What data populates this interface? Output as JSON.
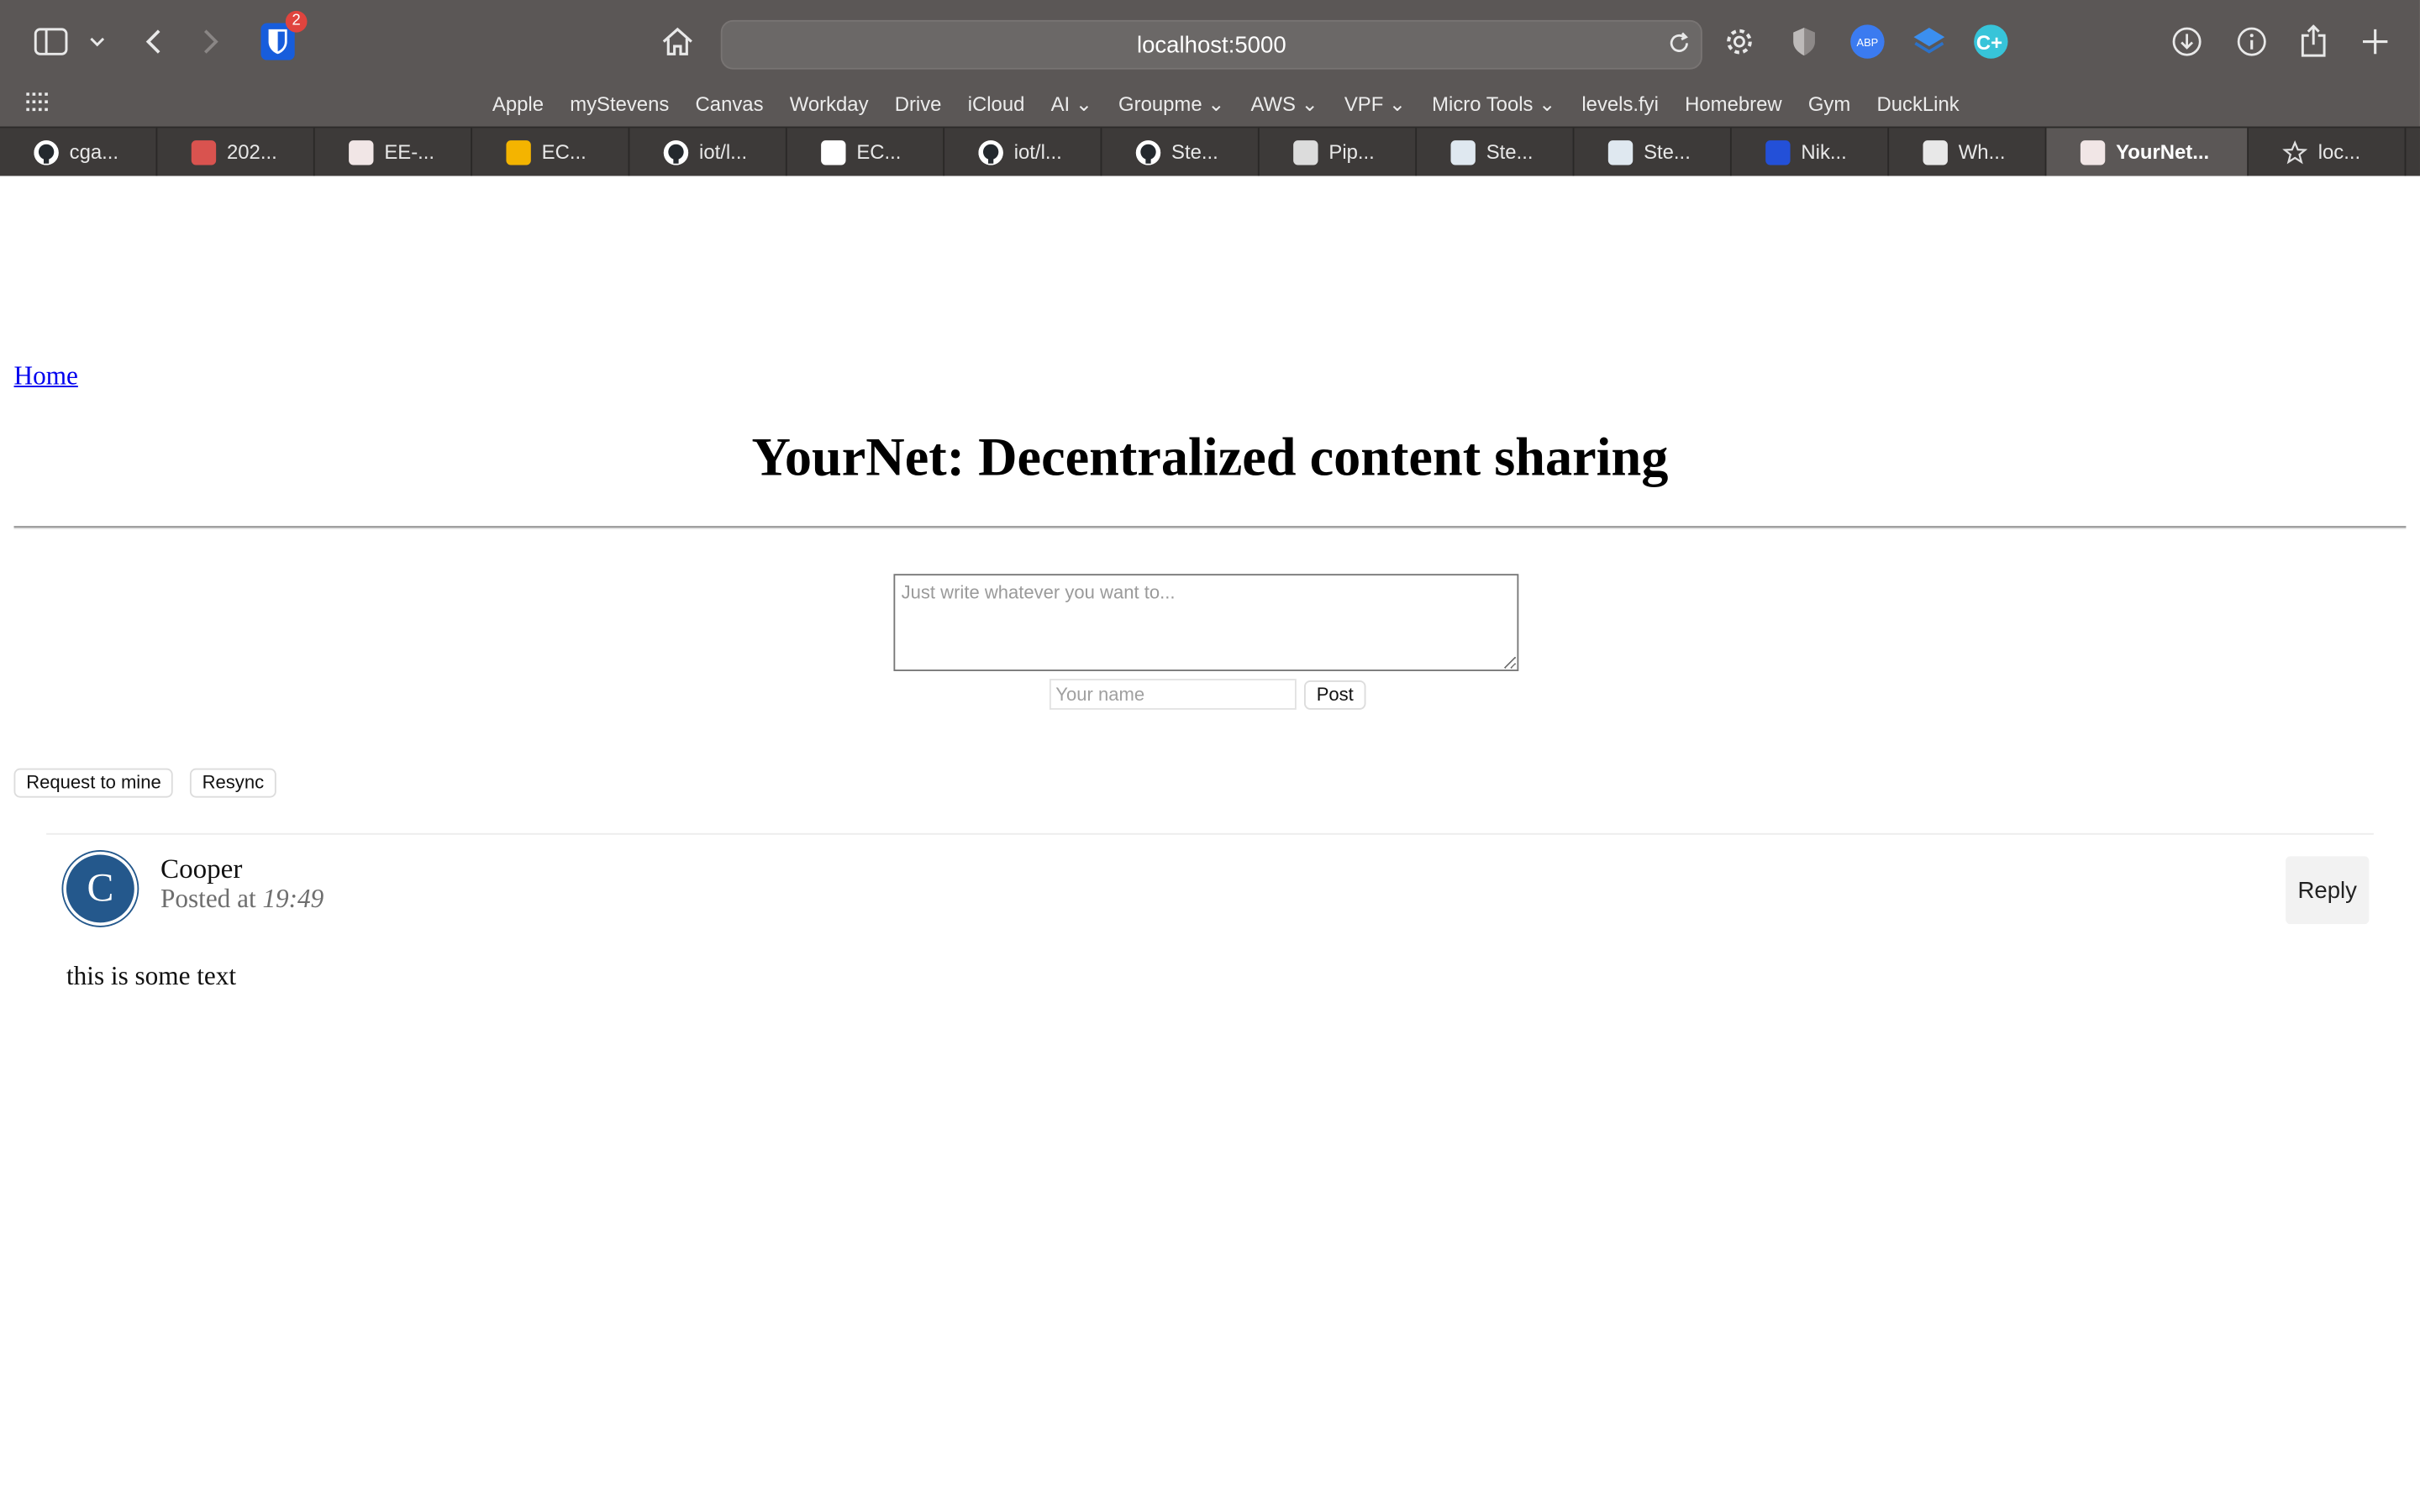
{
  "browser": {
    "url": "localhost:5000",
    "bitwarden_badge": "2",
    "bookmarks": [
      "Apple",
      "myStevens",
      "Canvas",
      "Workday",
      "Drive",
      "iCloud",
      "AI ⌄",
      "Groupme ⌄",
      "AWS ⌄",
      "VPF ⌄",
      "Micro Tools ⌄",
      "levels.fyi",
      "Homebrew",
      "Gym",
      "DuckLink"
    ],
    "tabs": [
      {
        "label": "cga...",
        "icon": "github-icon",
        "color": "#ffffff"
      },
      {
        "label": "202...",
        "icon": "red-logo-icon",
        "color": "#d9534f"
      },
      {
        "label": "EE-...",
        "icon": "stevens-icon",
        "color": "#f1e6e6"
      },
      {
        "label": "EC...",
        "icon": "slides-icon",
        "color": "#f4b400"
      },
      {
        "label": "iot/l...",
        "icon": "github-icon",
        "color": "#ffffff"
      },
      {
        "label": "EC...",
        "icon": "google-icon",
        "color": "#ffffff"
      },
      {
        "label": "iot/l...",
        "icon": "github-icon",
        "color": "#ffffff"
      },
      {
        "label": "Ste...",
        "icon": "github-icon",
        "color": "#ffffff"
      },
      {
        "label": "Pip...",
        "icon": "panel-icon",
        "color": "#dcdcdc"
      },
      {
        "label": "Ste...",
        "icon": "stevens-icon",
        "color": "#dfe8f0"
      },
      {
        "label": "Ste...",
        "icon": "stevens-icon",
        "color": "#dfe8f0"
      },
      {
        "label": "Nik...",
        "icon": "blue-logo-icon",
        "color": "#2350d8"
      },
      {
        "label": "Wh...",
        "icon": "s-icon",
        "color": "#e8e8e8"
      },
      {
        "label": "YourNet...",
        "icon": "stevens-icon",
        "color": "#f1e6e6",
        "active": true
      },
      {
        "label": "loc...",
        "icon": "star-icon",
        "color": "transparent"
      }
    ]
  },
  "page": {
    "home_link": "Home",
    "title": "YourNet: Decentralized content sharing",
    "compose_placeholder": "Just write whatever you want to...",
    "name_placeholder": "Your name",
    "post_button": "Post",
    "request_button": "Request to mine",
    "resync_button": "Resync"
  },
  "post": {
    "avatar_letter": "C",
    "author": "Cooper",
    "posted_prefix": "Posted at",
    "time": "19:49",
    "reply_label": "Reply",
    "text": "this is some text"
  }
}
